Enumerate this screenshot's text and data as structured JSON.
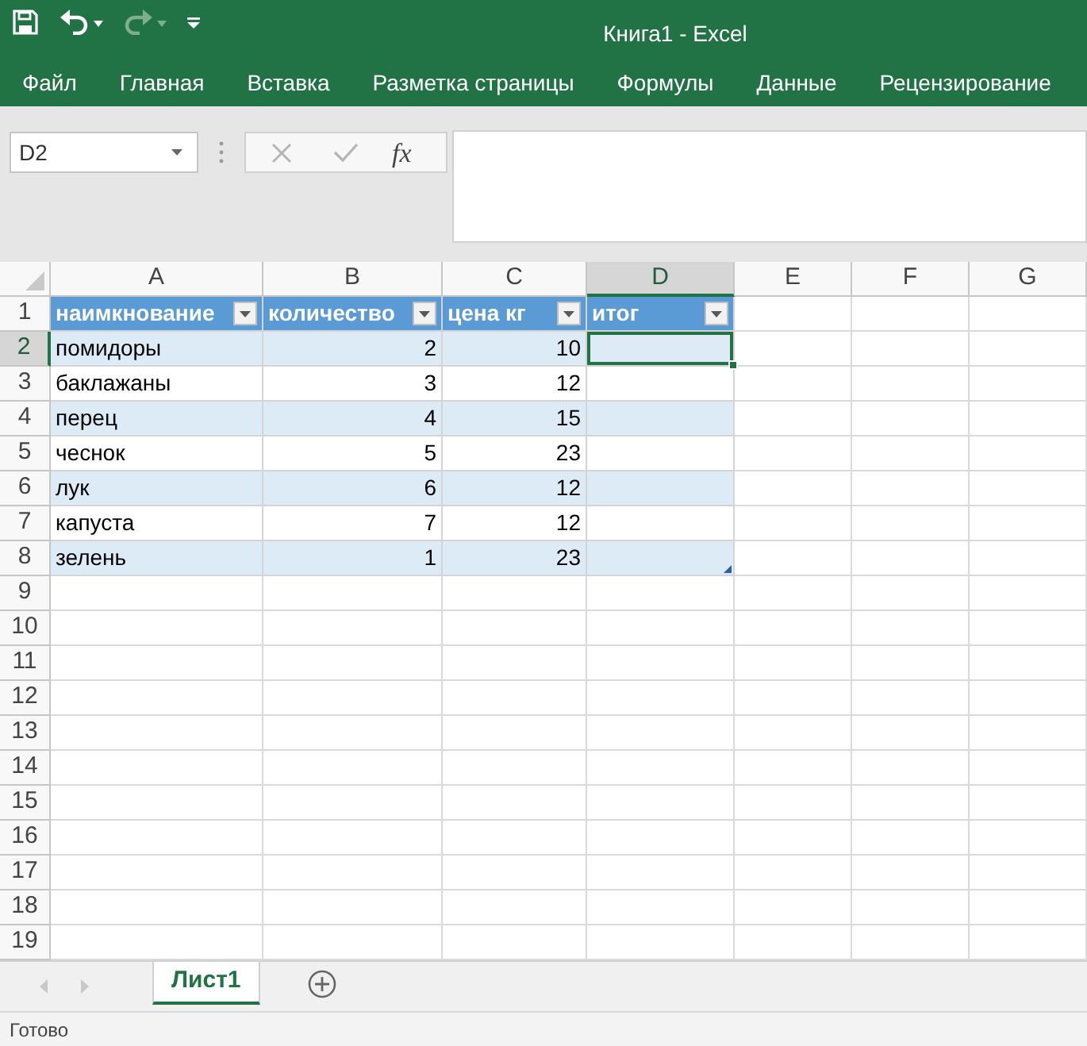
{
  "quick_access": [
    {
      "kind": "save",
      "disabled": false
    },
    {
      "kind": "undo",
      "disabled": false
    },
    {
      "kind": "redo",
      "disabled": true
    },
    {
      "kind": "customize",
      "disabled": false
    }
  ],
  "window": {
    "title": "Книга1 - Excel"
  },
  "ribbon_tabs": [
    {
      "label": "Файл",
      "selected": false
    },
    {
      "label": "Главная",
      "selected": false
    },
    {
      "label": "Вставка",
      "selected": false
    },
    {
      "label": "Разметка страницы",
      "selected": false
    },
    {
      "label": "Формулы",
      "selected": false
    },
    {
      "label": "Данные",
      "selected": false
    },
    {
      "label": "Рецензирование",
      "selected": false
    }
  ],
  "formula_bar": {
    "name_box": "D2",
    "function_label": "fx"
  },
  "grid": {
    "columns": [
      {
        "label": "A",
        "selected": false
      },
      {
        "label": "B",
        "selected": false
      },
      {
        "label": "C",
        "selected": false
      },
      {
        "label": "D",
        "selected": true
      },
      {
        "label": "E",
        "selected": false
      },
      {
        "label": "F",
        "selected": false
      },
      {
        "label": "G",
        "selected": false
      }
    ],
    "rows": [
      {
        "label": "1",
        "selected": false
      },
      {
        "label": "2",
        "selected": true
      },
      {
        "label": "3",
        "selected": false
      },
      {
        "label": "4",
        "selected": false
      },
      {
        "label": "5",
        "selected": false
      },
      {
        "label": "6",
        "selected": false
      },
      {
        "label": "7",
        "selected": false
      },
      {
        "label": "8",
        "selected": false
      },
      {
        "label": "9",
        "selected": false
      },
      {
        "label": "10",
        "selected": false
      },
      {
        "label": "11",
        "selected": false
      },
      {
        "label": "12",
        "selected": false
      },
      {
        "label": "13",
        "selected": false
      },
      {
        "label": "14",
        "selected": false
      },
      {
        "label": "15",
        "selected": false
      },
      {
        "label": "16",
        "selected": false
      },
      {
        "label": "17",
        "selected": false
      },
      {
        "label": "18",
        "selected": false
      },
      {
        "label": "19",
        "selected": false
      }
    ]
  },
  "table": {
    "headers": [
      "наимкнование",
      "количество",
      "цена кг",
      "итог"
    ],
    "rows": [
      [
        "помидоры",
        "2",
        "10"
      ],
      [
        "баклажаны",
        "3",
        "12"
      ],
      [
        "перец",
        "4",
        "15"
      ],
      [
        "чеснок",
        "5",
        "23"
      ],
      [
        "лук",
        "6",
        "12"
      ],
      [
        "капуста",
        "7",
        "12"
      ],
      [
        "зелень",
        "1",
        "23"
      ]
    ]
  },
  "sheet_tabs": [
    {
      "label": "Лист1",
      "selected": true
    }
  ],
  "status_bar": {
    "text": "Готово"
  }
}
